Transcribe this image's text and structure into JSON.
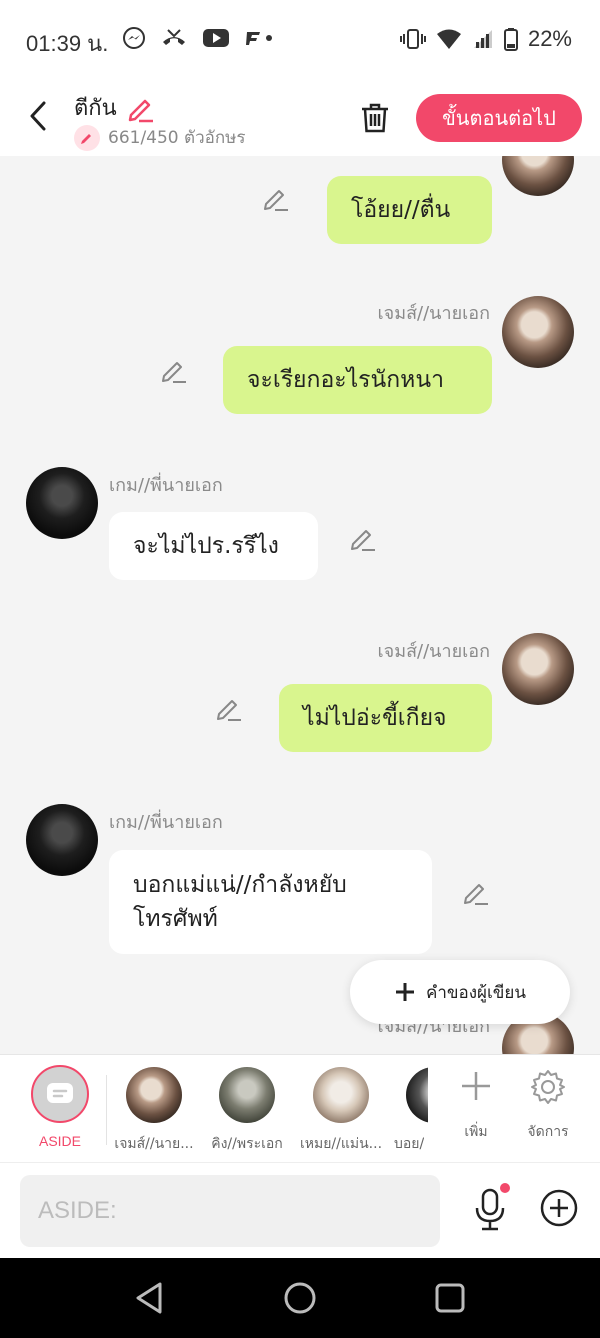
{
  "status_bar": {
    "time": "01:39 น.",
    "battery": "22%"
  },
  "header": {
    "title": "ตีกัน",
    "counter": "661/450 ตัวอักษร",
    "next_button": "ขั้นตอนต่อไป"
  },
  "messages": [
    {
      "side": "right",
      "sender": "",
      "text": "โอ้ยย//ตื่น"
    },
    {
      "side": "right",
      "sender": "เจมส์//นายเอก",
      "text": "จะเรียกอะไรนักหนา"
    },
    {
      "side": "left",
      "sender": "เกม//พี่นายเอก",
      "text": "จะไม่ไปร.รรึไง"
    },
    {
      "side": "right",
      "sender": "เจมส์//นายเอก",
      "text": "ไม่ไปอ่ะขี้เกียจ"
    },
    {
      "side": "left",
      "sender": "เกม//พี่นายเอก",
      "text_line1": "บอกแม่แน่//กำลังหยับ",
      "text_line2": "โทรศัพท์"
    },
    {
      "side": "right",
      "sender": "เจมส์//นายเอก",
      "text": ""
    }
  ],
  "author_button": "คำของผู้เขียน",
  "characters": {
    "aside_label": "ASIDE",
    "items": [
      {
        "label": "เจมส์//นาย..."
      },
      {
        "label": "คิง//พระเอก"
      },
      {
        "label": "เหมย//แม่น..."
      },
      {
        "label": "บอย/"
      }
    ],
    "add_label": "เพิ่ม",
    "manage_label": "จัดการ"
  },
  "input": {
    "placeholder": "ASIDE:"
  },
  "icons": {
    "status": [
      "messenger-icon",
      "missed-call-icon",
      "youtube-icon",
      "notification-icon",
      "vibrate-icon",
      "wifi-icon",
      "signal-icon",
      "battery-icon"
    ],
    "header": [
      "back-icon",
      "pencil-icon",
      "trash-icon"
    ],
    "input": [
      "microphone-icon",
      "add-circle-icon"
    ],
    "nav": [
      "nav-back-icon",
      "nav-home-icon",
      "nav-recents-icon"
    ]
  },
  "colors": {
    "accent": "#f2486a",
    "bubble_right": "#d9f58e",
    "bubble_left": "#ffffff",
    "background": "#f4f4f4"
  }
}
